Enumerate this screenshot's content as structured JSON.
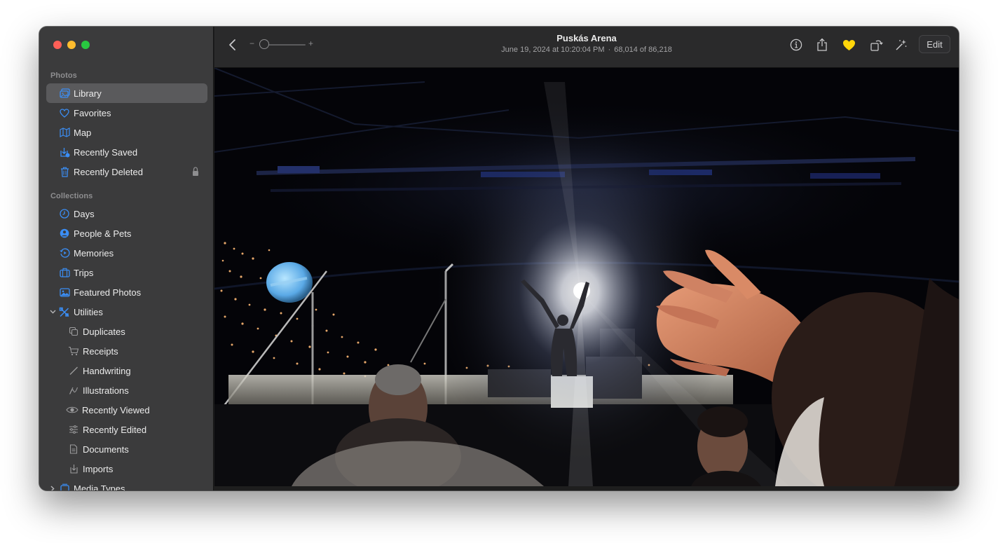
{
  "window": {
    "title": "Puskás Arena",
    "subtitle_date": "June 19, 2024 at 10:20:04 PM",
    "subtitle_count": "68,014 of 86,218",
    "edit_label": "Edit",
    "zoom_minus": "−",
    "zoom_plus": "+"
  },
  "sidebar": {
    "photos_header": "Photos",
    "collections_header": "Collections",
    "items": {
      "library": "Library",
      "favorites": "Favorites",
      "map": "Map",
      "recently_saved": "Recently Saved",
      "recently_deleted": "Recently Deleted",
      "days": "Days",
      "people_pets": "People & Pets",
      "memories": "Memories",
      "trips": "Trips",
      "featured_photos": "Featured Photos",
      "utilities": "Utilities",
      "duplicates": "Duplicates",
      "receipts": "Receipts",
      "handwriting": "Handwriting",
      "illustrations": "Illustrations",
      "recently_viewed": "Recently Viewed",
      "recently_edited": "Recently Edited",
      "documents": "Documents",
      "imports": "Imports",
      "media_types": "Media Types"
    }
  },
  "colors": {
    "accent_blue": "#3b8ef5",
    "favorite_yellow": "#ffd60a",
    "sidebar_bg": "#3b3b3c",
    "selection": "#5a5a5c"
  },
  "icons": {
    "toolbar": [
      "back-chevron-icon",
      "info-icon",
      "share-icon",
      "heart-icon",
      "rotate-icon",
      "magic-wand-icon"
    ]
  }
}
